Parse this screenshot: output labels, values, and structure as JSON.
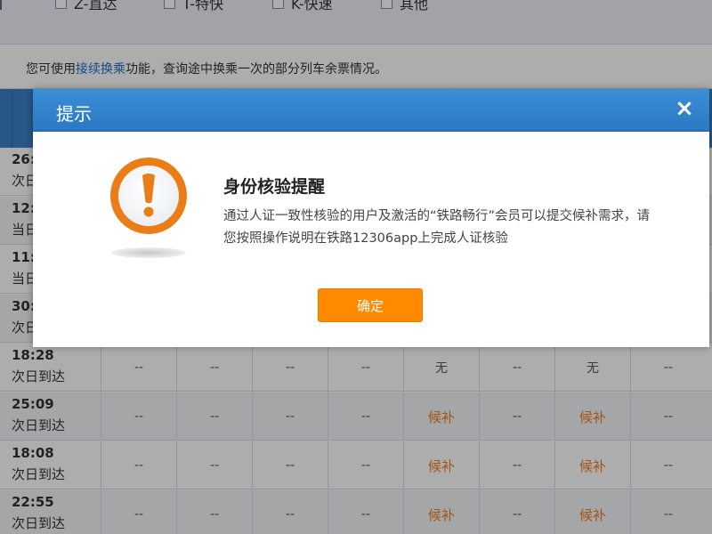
{
  "filters": {
    "items": [
      {
        "label": "Z-直达"
      },
      {
        "label": "T-特快"
      },
      {
        "label": "K-快速"
      },
      {
        "label": "其他"
      }
    ]
  },
  "notice": {
    "prefix": "您可使用",
    "link": "接续换乘",
    "suffix": "功能，查询途中换乘一次的部分列车余票情况。"
  },
  "rows": [
    {
      "time": "26:",
      "arrival": "次日"
    },
    {
      "time": "12:",
      "arrival": "当日"
    },
    {
      "time": "11:",
      "arrival": "当日"
    },
    {
      "time": "30:",
      "arrival": "次日"
    },
    {
      "time": "18:28",
      "arrival": "次日到达",
      "cells": [
        "--",
        "--",
        "--",
        "--",
        "无",
        "--",
        "无",
        "--"
      ]
    },
    {
      "time": "25:09",
      "arrival": "次日到达",
      "cells": [
        "--",
        "--",
        "--",
        "--",
        "候补",
        "--",
        "候补",
        "--"
      ]
    },
    {
      "time": "18:08",
      "arrival": "次日到达",
      "cells": [
        "--",
        "--",
        "--",
        "--",
        "候补",
        "--",
        "候补",
        "--"
      ]
    },
    {
      "time": "22:55",
      "arrival": "次日到达",
      "cells": [
        "--",
        "--",
        "--",
        "--",
        "候补",
        "--",
        "候补",
        "--"
      ]
    }
  ],
  "dialog": {
    "title": "提示",
    "close": "×",
    "heading": "身份核验提醒",
    "body": "通过人证一致性核验的用户及激活的“铁路畅行”会员可以提交候补需求，请您按照操作说明在铁路12306app上完成人证核验",
    "confirm": "确定"
  },
  "colors": {
    "header_blue": "#2b78c4",
    "accent_orange": "#ff8a00",
    "link_blue": "#1f6fc2",
    "waitlist_orange": "#f27c1f"
  },
  "icons": {
    "alert": "exclamation-circle-icon",
    "close": "close-icon",
    "checkbox": "checkbox-icon"
  }
}
